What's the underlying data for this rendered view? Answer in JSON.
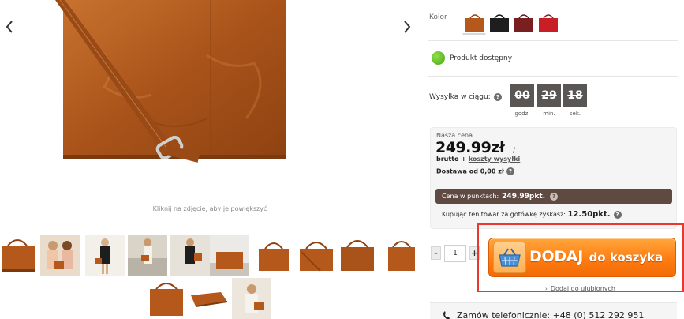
{
  "gallery": {
    "zoom_hint": "Kliknij na zdjęcie, aby je powiększyć",
    "arrow_prev": "‹",
    "arrow_next": "›"
  },
  "product": {
    "color_label": "Kolor",
    "colors": [
      {
        "name": "brown",
        "hex": "#b5581c"
      },
      {
        "name": "black",
        "hex": "#1e1e1e"
      },
      {
        "name": "burgundy",
        "hex": "#7a1f1f"
      },
      {
        "name": "red",
        "hex": "#c81f26"
      }
    ],
    "availability": "Produkt dostępny",
    "shipping_label": "Wysyłka w ciągu:",
    "countdown": [
      {
        "value": "00",
        "unit": "godz."
      },
      {
        "value": "29",
        "unit": "min."
      },
      {
        "value": "18",
        "unit": "sek."
      }
    ]
  },
  "price": {
    "label": "Nasza cena",
    "value": "249.99zł",
    "slash": "/",
    "brutto": "brutto",
    "plus": "+",
    "shipping_link": "koszty wysyłki",
    "delivery": "Dostawa od 0,00 zł",
    "points_label": "Cena w punktach:",
    "points_value": "249.99pkt.",
    "cash_points_label": "Kupując ten towar za gotówkę zyskasz:",
    "cash_points_value": "12.50pkt."
  },
  "cart": {
    "qty_minus": "-",
    "qty_plus": "+",
    "quantity": "1",
    "add_big": "DODAJ",
    "add_small": "do koszyka",
    "favorites": "Dodaj do ulubionych"
  },
  "contact": {
    "phone_text": "Zamów telefonicznie: +48 (0) 512 292 951"
  },
  "colors": {
    "leather": "#b5581c",
    "cta_orange": "#ff7d12",
    "points_bar": "#5f4a42",
    "highlight": "#e8382f",
    "available": "#5bbf1c"
  }
}
